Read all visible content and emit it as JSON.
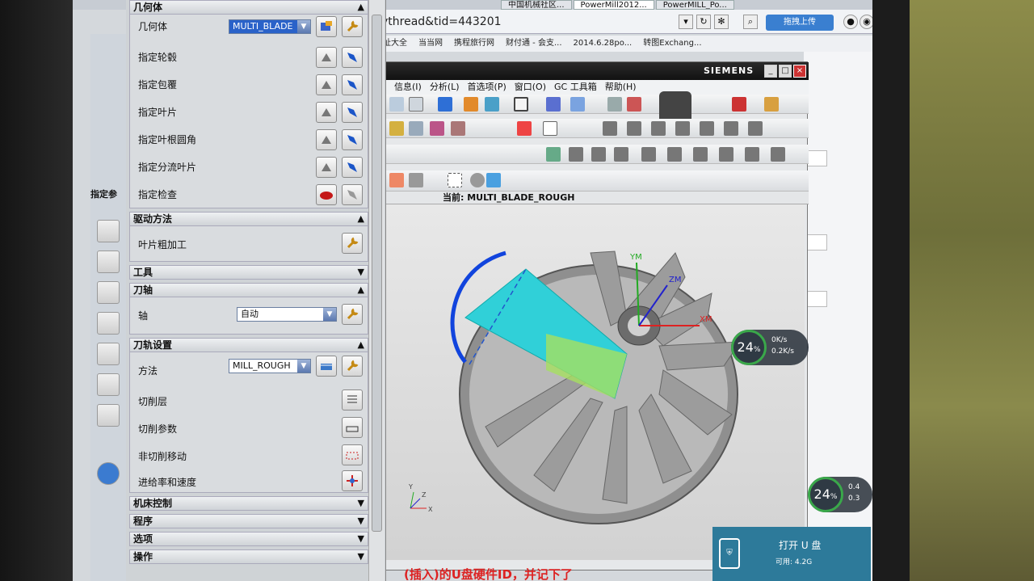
{
  "browser": {
    "tabs": [
      "中国机械社区...",
      "PowerMill2012...",
      "PowerMILL_Po..."
    ],
    "url": "ythread&tid=443201",
    "upload_label": "拖拽上传",
    "bookmarks": [
      "址大全",
      "当当网",
      "携程旅行网",
      "财付通 - 会支...",
      "2014.6.28po...",
      "转图Exchang..."
    ]
  },
  "nx": {
    "brand": "SIEMENS",
    "menu": [
      "信息(I)",
      "分析(L)",
      "首选项(P)",
      "窗口(O)",
      "GC 工具箱",
      "帮助(H)"
    ],
    "current_label": "当前: MULTI_BLADE_ROUGH",
    "axes": {
      "xm": "XM",
      "ym": "YM",
      "zm": "ZM",
      "x": "X",
      "y": "Y",
      "z": "Z"
    }
  },
  "dialog": {
    "geometry": {
      "header": "几何体",
      "geometry_label": "几何体",
      "geometry_value": "MULTI_BLADE",
      "rows": [
        "指定轮毂",
        "指定包覆",
        "指定叶片",
        "指定叶根圆角",
        "指定分流叶片",
        "指定检查"
      ]
    },
    "drive": {
      "header": "驱动方法",
      "label": "叶片粗加工"
    },
    "tool": {
      "header": "工具"
    },
    "axis": {
      "header": "刀轴",
      "label": "轴",
      "value": "自动"
    },
    "toolpath": {
      "header": "刀轨设置",
      "method_label": "方法",
      "method_value": "MILL_ROUGH",
      "rows": [
        "切削层",
        "切削参数",
        "非切削移动",
        "进给率和速度"
      ]
    },
    "collapsed": [
      "机床控制",
      "程序",
      "选项",
      "操作"
    ],
    "left_tab_label": "指定参"
  },
  "overlays": {
    "net1": {
      "percent": "24",
      "unit": "%",
      "up": "0K/s",
      "down": "0.2K/s"
    },
    "net2": {
      "percent": "24",
      "unit": "%",
      "up": "0.4",
      "down": "0.3"
    },
    "usb": {
      "title": "打开 U 盘",
      "capacity": "可用: 4.2G"
    },
    "bottom_text": "(插入)的U盘硬件ID，并记下了"
  },
  "colors": {
    "accent": "#2a62c9",
    "nx_title": "#111111",
    "usb": "#2d7a9a",
    "toolpath": "#30d0d8"
  }
}
